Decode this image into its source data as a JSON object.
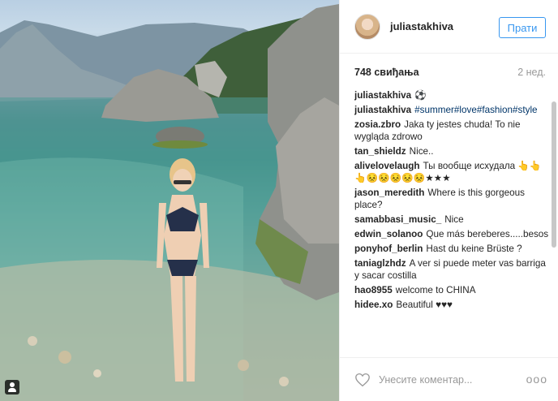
{
  "post": {
    "username": "juliastakhiva",
    "follow_label": "Прати",
    "likes": "748 свиђања",
    "time": "2 нед."
  },
  "comments": [
    {
      "user": "juliastakhiva",
      "text": "⚽",
      "tags": false
    },
    {
      "user": "juliastakhiva",
      "text": "#summer#love#fashion#style",
      "tags": true
    },
    {
      "user": "zosia.zbro",
      "text": "Jaka ty jestes chuda! To nie wygląda zdrowo",
      "tags": false
    },
    {
      "user": "tan_shieldz",
      "text": "Nice..",
      "tags": false
    },
    {
      "user": "alivelovelaugh",
      "text": "Ты вообще исхудала 👆👆👆😣😣😣😣😣★★★",
      "tags": false
    },
    {
      "user": "jason_meredith",
      "text": "Where is this gorgeous place?",
      "tags": false
    },
    {
      "user": "samabbasi_music_",
      "text": "Nice",
      "tags": false
    },
    {
      "user": "edwin_solanoo",
      "text": "Que más bereberes.....besos",
      "tags": false
    },
    {
      "user": "ponyhof_berlin",
      "text": "Hast du keine Brüste ?",
      "tags": false
    },
    {
      "user": "taniaglzhdz",
      "text": "A ver si puede meter vas barriga y sacar costilla",
      "tags": false
    },
    {
      "user": "hao8955",
      "text": "welcome to CHINA",
      "tags": false
    },
    {
      "user": "hidee.xo",
      "text": "Beautiful ♥♥♥",
      "tags": false
    }
  ],
  "footer": {
    "comment_placeholder": "Унесите коментар...",
    "more_label": "ооо"
  },
  "icons": {
    "heart": "heart-icon",
    "more": "more-options-icon",
    "user_tag": "user-tag-icon"
  }
}
